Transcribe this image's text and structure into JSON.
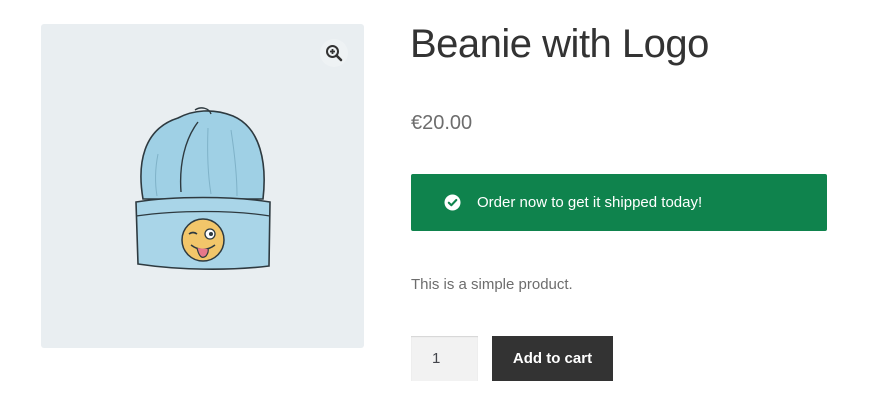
{
  "product": {
    "title": "Beanie with Logo",
    "price": "€20.00",
    "description": "This is a simple product.",
    "image_icon": "zoom-in-icon"
  },
  "notice": {
    "text": "Order now to get it shipped today!",
    "icon": "check-circle-icon",
    "color": "#0f834d"
  },
  "cart_form": {
    "quantity": "1",
    "add_to_cart_label": "Add to cart",
    "button_color": "#333333"
  }
}
